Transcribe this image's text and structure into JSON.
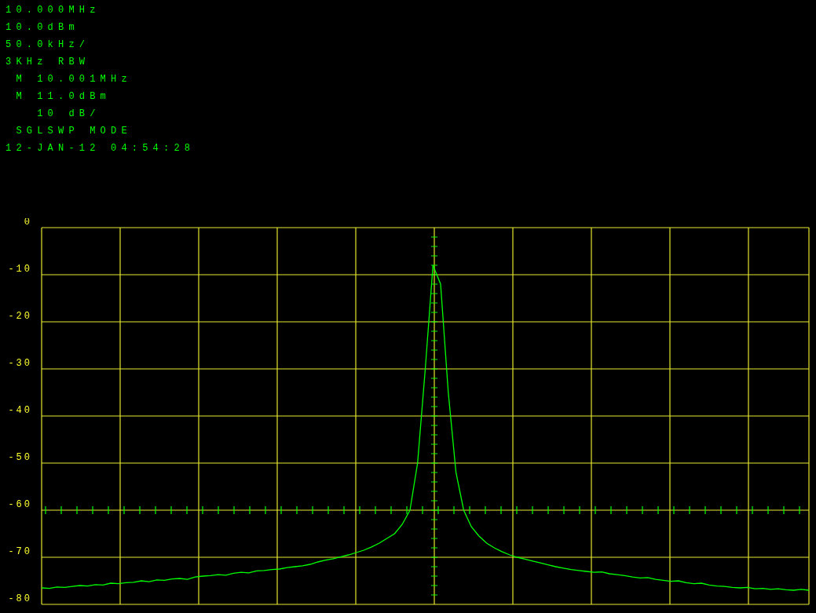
{
  "readouts": [
    "10.000MHz",
    "10.0dBm",
    "50.0kHz/",
    "3KHz RBW",
    " M 10.001MHz",
    " M 11.0dBm",
    "   10 dB/",
    " SGLSWP MODE",
    "12-JAN-12 04:54:28"
  ],
  "display": {
    "chart_data": {
      "type": "line",
      "grid": true,
      "ylim": [
        -80,
        0
      ],
      "yticks": [
        0,
        -10,
        -20,
        -30,
        -40,
        -50,
        -60,
        -70,
        -80
      ],
      "series": [
        {
          "color": "#00ff00",
          "values": [
            -76.5,
            -76.6,
            -76.3,
            -76.4,
            -76.2,
            -76.0,
            -76.1,
            -75.8,
            -75.9,
            -75.5,
            -75.6,
            -75.4,
            -75.3,
            -75.0,
            -75.2,
            -74.8,
            -74.9,
            -74.6,
            -74.5,
            -74.7,
            -74.2,
            -74.0,
            -73.9,
            -73.7,
            -73.8,
            -73.4,
            -73.2,
            -73.3,
            -72.9,
            -72.8,
            -72.6,
            -72.5,
            -72.2,
            -72.0,
            -71.8,
            -71.5,
            -71.0,
            -70.6,
            -70.3,
            -69.9,
            -69.5,
            -69.0,
            -68.5,
            -67.8,
            -67.0,
            -66.0,
            -65.0,
            -63.0,
            -60.0,
            -50.0,
            -30.0,
            -8.0,
            -12.0,
            -35.0,
            -52.0,
            -60.0,
            -63.5,
            -65.5,
            -67.0,
            -68.0,
            -68.8,
            -69.5,
            -70.0,
            -70.4,
            -70.8,
            -71.2,
            -71.6,
            -72.0,
            -72.3,
            -72.6,
            -72.8,
            -73.0,
            -73.2,
            -73.1,
            -73.5,
            -73.7,
            -73.9,
            -74.2,
            -74.4,
            -74.3,
            -74.7,
            -74.9,
            -75.1,
            -75.0,
            -75.4,
            -75.6,
            -75.5,
            -75.9,
            -76.1,
            -76.2,
            -76.4,
            -76.5,
            -76.4,
            -76.7,
            -76.6,
            -76.8,
            -76.7,
            -76.9,
            -77.0,
            -76.8,
            -77.0
          ]
        }
      ]
    }
  }
}
